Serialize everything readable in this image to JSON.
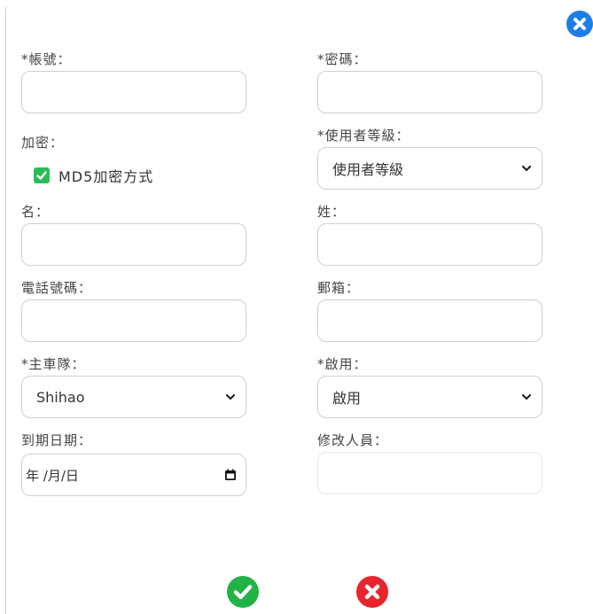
{
  "form": {
    "account_label": "*帳號：",
    "password_label": "*密碼：",
    "encrypt_label": "加密：",
    "md5_label": "MD5加密方式",
    "md5_checked": true,
    "user_level_label": "*使用者等級：",
    "user_level_value": "使用者等級",
    "first_name_label": "名：",
    "last_name_label": "姓：",
    "phone_label": "電話號碼：",
    "email_label": "郵箱：",
    "main_fleet_label": "*主車隊：",
    "main_fleet_value": "Shihao",
    "enabled_label": "*啟用：",
    "enabled_value": "啟用",
    "expiry_label": "到期日期：",
    "expiry_placeholder": "年 /月/日",
    "modifier_label": "修改人員："
  },
  "colors": {
    "close": "#1e7ee8",
    "confirm": "#21b345",
    "cancel": "#e8242c",
    "checkbox": "#2bbd55"
  },
  "icons": {
    "close": "close-icon",
    "confirm": "check-icon",
    "cancel": "x-icon",
    "calendar": "calendar-icon",
    "chevron": "chevron-down-icon"
  }
}
